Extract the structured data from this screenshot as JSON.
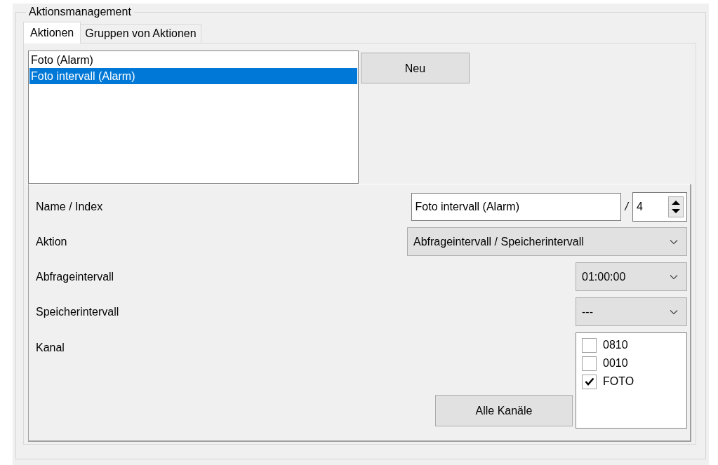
{
  "group": {
    "title": "Aktionsmanagement"
  },
  "tabs": [
    {
      "label": "Aktionen",
      "selected": true
    },
    {
      "label": "Gruppen von Aktionen",
      "selected": false
    }
  ],
  "actions": [
    {
      "label": "Foto (Alarm)",
      "selected": false
    },
    {
      "label": "Foto intervall (Alarm)",
      "selected": true
    }
  ],
  "new_button": "Neu",
  "name_index": {
    "label": "Name  /  Index",
    "name": "Foto intervall (Alarm)",
    "separator": "/",
    "index": "4"
  },
  "action": {
    "label": "Aktion",
    "value": "Abfrageintervall / Speicherintervall"
  },
  "query_interval": {
    "label": "Abfrageintervall",
    "value": "01:00:00"
  },
  "storage_interval": {
    "label": "Speicherintervall",
    "value": "---"
  },
  "channel": {
    "label": "Kanal",
    "items": [
      {
        "label": "0810",
        "checked": false
      },
      {
        "label": "0010",
        "checked": false
      },
      {
        "label": "FOTO",
        "checked": true
      }
    ],
    "all_button": "Alle Kanäle"
  }
}
